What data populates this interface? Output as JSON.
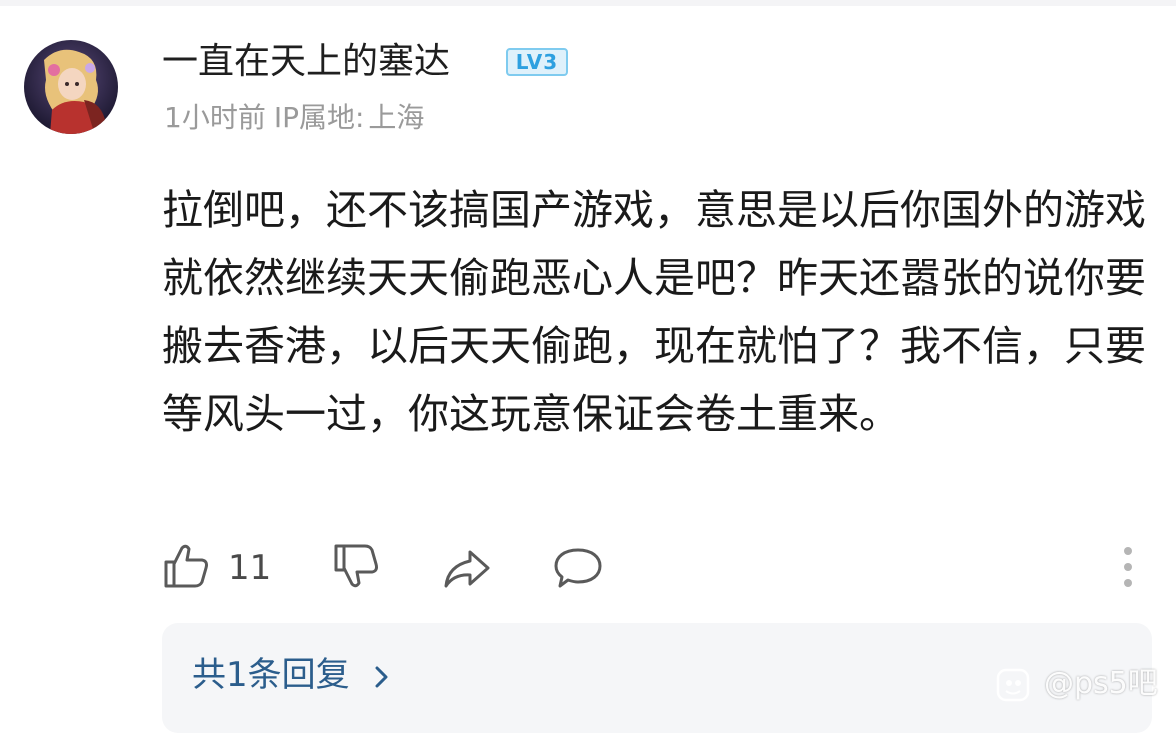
{
  "comment": {
    "author": {
      "name": "一直在天上的塞达",
      "level_badge": "LV3",
      "avatar": "avatar-image"
    },
    "meta": {
      "time": "1小时前",
      "ip_label": "IP属地:",
      "ip_city": "上海"
    },
    "body": "拉倒吧，还不该搞国产游戏，意思是以后你国外的游戏就依然继续天天偷跑恶心人是吧？昨天还嚣张的说你要搬去香港，以后天天偷跑，现在就怕了？我不信，只要等风头一过，你这玩意保证会卷土重来。",
    "actions": {
      "like_icon": "thumbs-up-icon",
      "like_count": "11",
      "dislike_icon": "thumbs-down-icon",
      "share_icon": "share-icon",
      "comment_icon": "comment-icon",
      "more_icon": "more-vertical-icon"
    },
    "replies": {
      "label": "共1条回复",
      "chevron_icon": "chevron-right-icon"
    }
  },
  "watermark": {
    "text": "@ps5吧",
    "logo_icon": "tieba-logo-icon"
  },
  "colors": {
    "link": "#2b5d8c",
    "badge": "#2ea0e0",
    "meta": "#9a9a9a"
  }
}
